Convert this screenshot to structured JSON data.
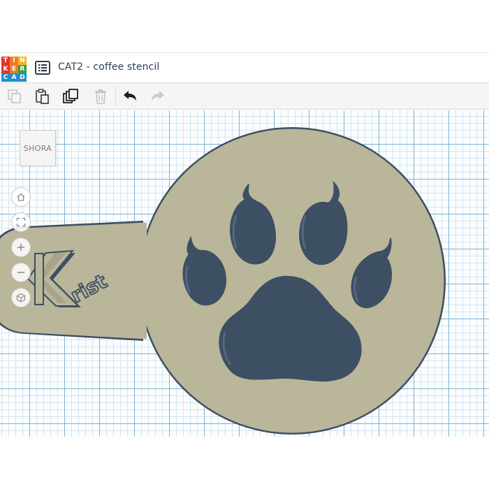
{
  "app": {
    "logo_letters": [
      "T",
      "I",
      "N",
      "K",
      "E",
      "R",
      "C",
      "A",
      "D"
    ],
    "logo_colors": [
      "#e2342c",
      "#f07c1e",
      "#f7b51b",
      "#e2342c",
      "#f07c1e",
      "#30a14e",
      "#1f8fd0",
      "#1f8fd0",
      "#1f8fd0"
    ],
    "menu_icon": "list-icon",
    "title": "CAT2 - coffee stencil"
  },
  "toolbar": {
    "buttons": [
      {
        "name": "copy-button",
        "icon": "copy-icon",
        "enabled": false
      },
      {
        "name": "paste-button",
        "icon": "paste-icon",
        "enabled": true
      },
      {
        "name": "duplicate-button",
        "icon": "duplicate-icon",
        "enabled": true
      },
      {
        "name": "delete-button",
        "icon": "trash-icon",
        "enabled": false
      },
      {
        "name": "undo-button",
        "icon": "undo-icon",
        "enabled": true
      },
      {
        "name": "redo-button",
        "icon": "redo-icon",
        "enabled": false
      }
    ]
  },
  "viewcube": {
    "label": "SHORA"
  },
  "nav_controls": [
    {
      "name": "home-view-button",
      "icon": "home-icon"
    },
    {
      "name": "fit-view-button",
      "icon": "fit-icon"
    },
    {
      "name": "zoom-in-button",
      "icon": "plus-icon"
    },
    {
      "name": "zoom-out-button",
      "icon": "minus-icon"
    },
    {
      "name": "orthographic-toggle-button",
      "icon": "cube-icon"
    }
  ],
  "model": {
    "name": "coffee stencil",
    "engraved_text": "rist",
    "logo_letter": "K",
    "shape_color": "#b9b69a",
    "edge_color": "#3d4f63",
    "cutout_shadow": "#6b7d8f"
  },
  "colors": {
    "title_text": "#2d3e50",
    "toolbar_bg": "#f5f5f5",
    "grid_major": "#7fb3d3",
    "grid_minor": "#d2e5f1"
  }
}
